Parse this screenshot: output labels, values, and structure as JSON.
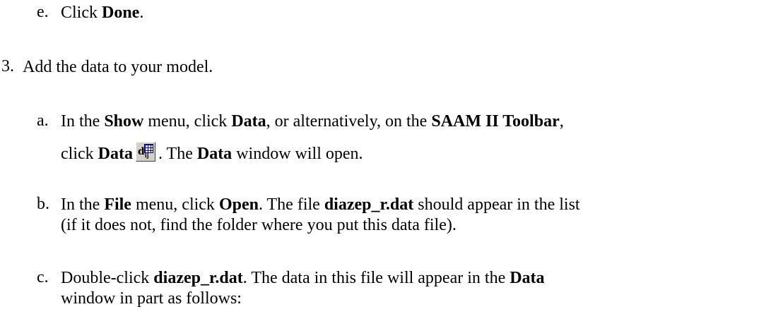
{
  "step_e": {
    "marker": "e.",
    "text_1": "Click ",
    "bold_1": "Done",
    "text_2": "."
  },
  "step_3": {
    "marker": "3.",
    "text": "Add the data to your model."
  },
  "step_a": {
    "marker": "a.",
    "text_1": "In the ",
    "bold_1": "Show",
    "text_2": " menu, click ",
    "bold_2": "Data",
    "text_3": ", or alternatively, on the ",
    "bold_3": "SAAM II Toolbar",
    "text_4": ",",
    "line2_text_1": "click ",
    "line2_bold_1": "Data",
    "line2_text_2": ". The ",
    "line2_bold_2": "Data",
    "line2_text_3": " window will open.",
    "icon": "data-window-icon"
  },
  "step_b": {
    "marker": "b.",
    "text_1": "In the ",
    "bold_1": "File",
    "text_2": " menu, click ",
    "bold_2": "Open",
    "text_3": ". The file ",
    "bold_3": "diazep_r.dat",
    "text_4": " should appear in the list",
    "line2": "(if it does not, find the folder where you put this data file)."
  },
  "step_c": {
    "marker": "c.",
    "text_1": "Double-click ",
    "bold_1": "diazep_r.dat",
    "text_2": ". The data in this file will appear in the ",
    "bold_2": "Data",
    "line2": "window in part as follows:"
  }
}
